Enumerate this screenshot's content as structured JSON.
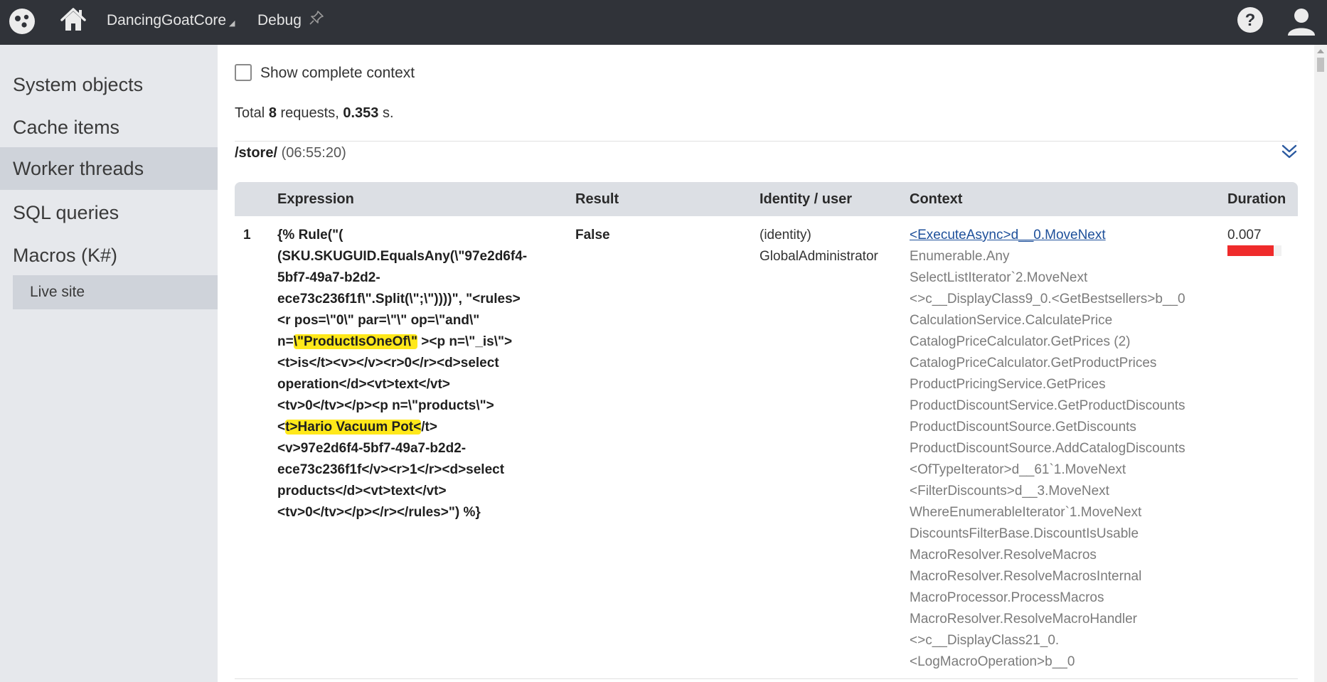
{
  "topbar": {
    "site_name": "DancingGoatCore",
    "site_caret": "◢",
    "app_name": "Debug"
  },
  "sidebar": {
    "items": [
      {
        "label": "System objects",
        "active": false
      },
      {
        "label": "Cache items",
        "active": false
      },
      {
        "label": "Worker threads",
        "active": true
      },
      {
        "label": "SQL queries",
        "active": false
      },
      {
        "label": "Macros (K#)",
        "active": false
      }
    ],
    "subitem": {
      "label": "Live site"
    }
  },
  "main": {
    "show_context_label": "Show complete context",
    "summary": {
      "prefix": "Total ",
      "count": "8",
      "mid": " requests, ",
      "time": "0.353",
      "suffix": " s."
    },
    "request": {
      "path": "/store/",
      "time": "(06:55:20)"
    },
    "columns": {
      "expression": "Expression",
      "result": "Result",
      "identity": "Identity / user",
      "context": "Context",
      "duration": "Duration"
    },
    "row": {
      "index": "1",
      "expression_lines": [
        "{% Rule(\"(",
        "(SKU.SKUGUID.EqualsAny(\\\"97e2d6f4-",
        "5bf7-49a7-b2d2-",
        "ece73c236f1f\\\".Split(\\\";\\\"))))\", \"<rules>",
        "<r pos=\\\"0\\\" par=\\\"\\\" op=\\\"and\\\"",
        "n=\\\"ProductIsOneOf\\\" ><p n=\\\"_is\\\">",
        "<t>is</t><v></v><r>0</r><d>select",
        "operation</d><vt>text</vt>",
        "<tv>0</tv></p><p n=\\\"products\\\">",
        "<t>Hario Vacuum Pot</t>",
        "<v>97e2d6f4-5bf7-49a7-b2d2-",
        "ece73c236f1f</v><r>1</r><d>select",
        "products</d><vt>text</vt>",
        "<tv>0</tv></p></r></rules>\") %}"
      ],
      "expr_line6_pre": "n=",
      "expr_line6_hl": "\\\"ProductIsOneOf\\\"",
      "expr_line6_post": " ><p n=\\\"_is\\\">",
      "expr_line10_pre": "<",
      "expr_line10_hl": "t>Hario Vacuum Pot<",
      "expr_line10_post": "/t>",
      "result": "False",
      "identity_line1": "(identity)",
      "identity_line2": "GlobalAdministrator",
      "context_link": "<ExecuteAsync>d__0.MoveNext",
      "context_lines": [
        "Enumerable.Any",
        "SelectListIterator`2.MoveNext",
        "<>c__DisplayClass9_0.<GetBestsellers>b__0",
        "CalculationService.CalculatePrice",
        "CatalogPriceCalculator.GetPrices (2)",
        "CatalogPriceCalculator.GetProductPrices",
        "ProductPricingService.GetPrices",
        "ProductDiscountService.GetProductDiscounts",
        "ProductDiscountSource.GetDiscounts",
        "ProductDiscountSource.AddCatalogDiscounts",
        "<OfTypeIterator>d__61`1.MoveNext",
        "<FilterDiscounts>d__3.MoveNext",
        "WhereEnumerableIterator`1.MoveNext",
        "DiscountsFilterBase.DiscountIsUsable",
        "MacroResolver.ResolveMacros",
        "MacroResolver.ResolveMacrosInternal",
        "MacroProcessor.ProcessMacros",
        "MacroResolver.ResolveMacroHandler",
        "<>c__DisplayClass21_0.",
        "<LogMacroOperation>b__0"
      ],
      "duration": "0.007",
      "duration_fraction": 0.85
    }
  },
  "colors": {
    "topbar_bg": "#303339",
    "sidebar_bg": "#e6e8ec",
    "active_item_bg": "#cfd3da",
    "highlight": "#ffe81a",
    "duration_bar": "#ef2b2b",
    "link": "#1d4f9a"
  }
}
